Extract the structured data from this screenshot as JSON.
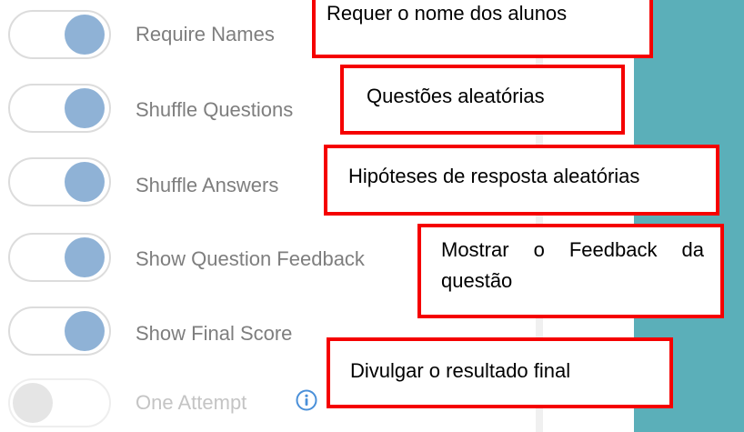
{
  "settings": [
    {
      "label": "Require Names",
      "state": "on"
    },
    {
      "label": "Shuffle Questions",
      "state": "on"
    },
    {
      "label": "Shuffle Answers",
      "state": "on"
    },
    {
      "label": "Show Question Feedback",
      "state": "on"
    },
    {
      "label": "Show Final Score",
      "state": "on"
    },
    {
      "label": "One Attempt",
      "state": "off"
    }
  ],
  "info_icon": "info-circle-icon",
  "colors": {
    "knob_on": "#8fb2d6",
    "knob_off": "#e5e5e5",
    "callout_border": "#f50000",
    "teal_panel": "#5bafb9"
  },
  "callouts": [
    {
      "text": "Requer o nome dos alunos"
    },
    {
      "text": "Questões aleatórias"
    },
    {
      "text": "Hipóteses de resposta aleatórias"
    },
    {
      "text": "Mostrar o Feedback da questão"
    },
    {
      "text": "Divulgar o resultado final"
    }
  ]
}
